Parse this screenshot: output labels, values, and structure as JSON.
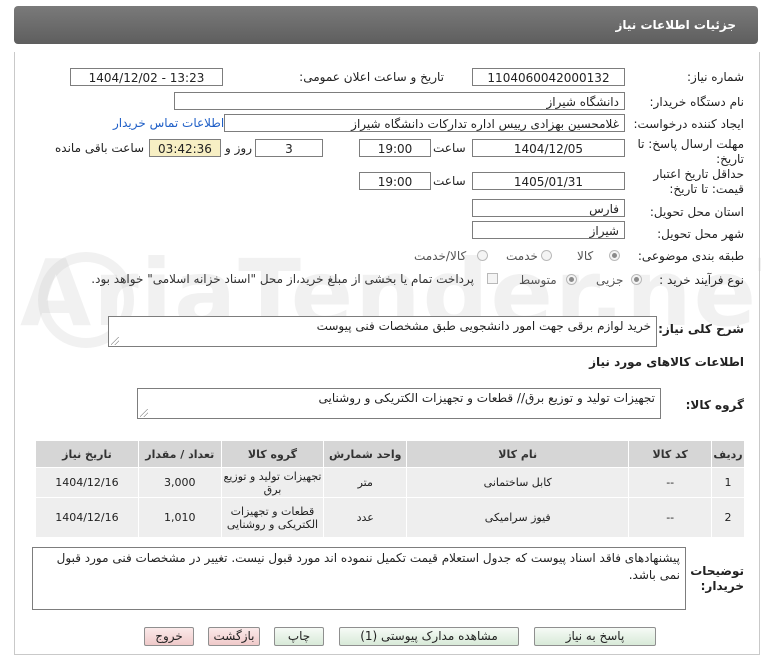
{
  "header": {
    "title": "جزئیات اطلاعات نیاز"
  },
  "form": {
    "need_number_label": "شماره نیاز:",
    "need_number": "1104060042000132",
    "announce_label": "تاریخ و ساعت اعلان عمومی:",
    "announce_value": "1404/12/02 - 13:23",
    "buyer_org_label": "نام دستگاه خریدار:",
    "buyer_org": "دانشگاه شیراز",
    "creator_label": "ایجاد کننده درخواست:",
    "creator": "غلامحسین بهزادی رییس اداره تداركات دانشگاه شیراز",
    "contact_link": "اطلاعات تماس خریدار",
    "deadline_label_1": "مهلت ارسال پاسخ: تا",
    "deadline_label_2": "تاریخ:",
    "deadline_date": "1404/12/05",
    "time_word": "ساعت",
    "deadline_time": "19:00",
    "days_value": "3",
    "days_word": "روز و",
    "remaining_time": "03:42:36",
    "remaining_label": "ساعت باقی مانده",
    "validity_label_1": "حداقل تاریخ اعتبار",
    "validity_label_2": "قیمت: تا تاریخ:",
    "validity_date": "1405/01/31",
    "validity_time": "19:00",
    "province_label": "استان محل تحویل:",
    "province": "فارس",
    "city_label": "شهر محل تحویل:",
    "city": "شیراز",
    "category_label": "طبقه بندی موضوعی:",
    "category_options": [
      "کالا",
      "خدمت",
      "کالا/خدمت"
    ],
    "category_selected": "کالا",
    "process_label": "نوع فرآیند خرید :",
    "process_options": [
      "جزیی",
      "متوسط"
    ],
    "process_selected": "جزیی",
    "process_note": "پرداخت تمام یا بخشی از مبلغ خرید،از محل \"اسناد خزانه اسلامی\" خواهد بود."
  },
  "description": {
    "label": "شرح کلی نیاز:",
    "value": "خرید لوازم برقی  جهت امور دانشجویی طبق مشخصات فنی پیوست"
  },
  "goods_info": {
    "title": "اطلاعات کالاهای مورد نیاز",
    "group_label": "گروه کالا:",
    "group_value": "تجهیزات تولید و توزیع برق// قطعات و تجهیزات الکتریکی و روشنایی"
  },
  "table": {
    "headers": [
      "ردیف",
      "کد کالا",
      "نام کالا",
      "واحد شمارش",
      "گروه کالا",
      "تعداد / مقدار",
      "تاریخ نیاز"
    ],
    "rows": [
      {
        "index": "1",
        "code": "--",
        "name": "کابل ساختمانی",
        "unit": "متر",
        "group": "تجهیزات تولید و توزیع برق",
        "qty": "3,000",
        "date": "1404/12/16"
      },
      {
        "index": "2",
        "code": "--",
        "name": "فیوز سرامیکی",
        "unit": "عدد",
        "group": "قطعات و تجهیزات الکتریکی و روشنایی",
        "qty": "1,010",
        "date": "1404/12/16"
      }
    ]
  },
  "buyer_notes": {
    "label_1": "توضیحات",
    "label_2": "خریدار:",
    "value": "پیشنهادهای فاقد اسناد پیوست که جدول استعلام قیمت تکمیل ننموده اند مورد قبول نیست. تغییر در مشخصات فنی مورد قبول نمی باشد."
  },
  "buttons": {
    "reply": "پاسخ به نیاز",
    "attachments": "مشاهده مدارک پیوستی (1)",
    "print": "چاپ",
    "back": "بازگشت",
    "exit": "خروج"
  },
  "watermark": "AriaTender.neT"
}
